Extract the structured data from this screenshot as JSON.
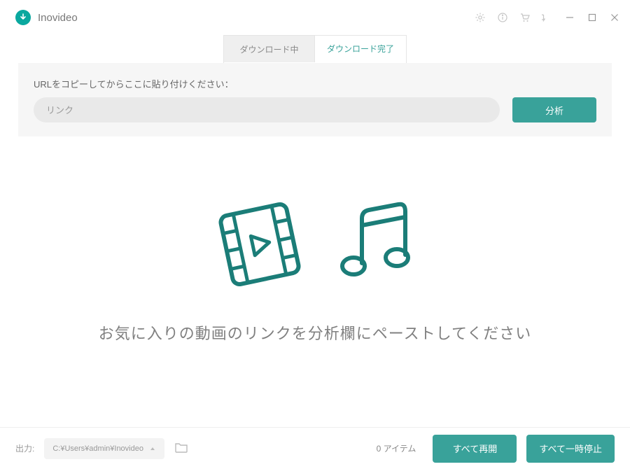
{
  "app": {
    "title": "Inovideo"
  },
  "tabs": {
    "downloading": "ダウンロード中",
    "completed": "ダウンロード完了"
  },
  "url_panel": {
    "label": "URLをコピーしてからここに貼り付けください：",
    "placeholder": "リンク",
    "analyze": "分析"
  },
  "empty": {
    "message": "お気に入りの動画のリンクを分析欄にペーストしてください"
  },
  "footer": {
    "output_label": "出力:",
    "path": "C:¥Users¥admin¥Inovideo",
    "item_count": "0 アイテム",
    "resume_all": "すべて再開",
    "pause_all": "すべて一時停止"
  }
}
